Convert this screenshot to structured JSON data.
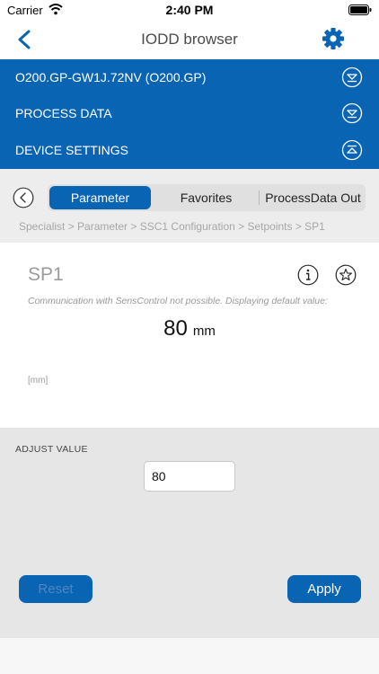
{
  "status_bar": {
    "carrier": "Carrier",
    "time": "2:40 PM"
  },
  "nav": {
    "title": "IODD browser"
  },
  "sections": [
    {
      "label": "O200.GP-GW1J.72NV (O200.GP)",
      "state": "collapsed"
    },
    {
      "label": "PROCESS DATA",
      "state": "collapsed"
    },
    {
      "label": "DEVICE SETTINGS",
      "state": "expanded"
    }
  ],
  "tabs": [
    {
      "label": "Parameter",
      "active": true
    },
    {
      "label": "Favorites",
      "active": false
    },
    {
      "label": "ProcessData Out",
      "active": false
    }
  ],
  "breadcrumb": "Specialist > Parameter > SSC1 Configuration > Setpoints > SP1",
  "parameter": {
    "name": "SP1",
    "note": "Communication with SensControl not possible. Displaying default value:",
    "value": "80",
    "unit": "mm",
    "unit_note": "[mm]"
  },
  "adjust": {
    "label": "ADJUST VALUE",
    "value": "80",
    "reset_label": "Reset",
    "apply_label": "Apply"
  },
  "colors": {
    "primary": "#0a64b4",
    "panel_gray": "#e6e6e6"
  }
}
